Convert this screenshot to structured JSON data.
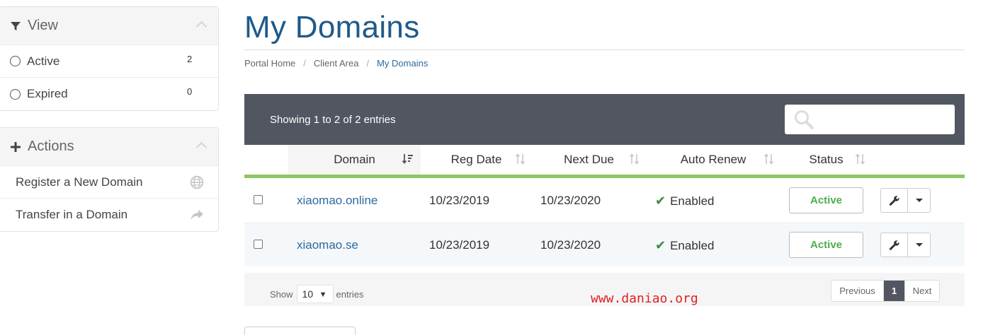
{
  "sidebar": {
    "view": {
      "title": "View",
      "items": [
        {
          "label": "Active",
          "count": "2"
        },
        {
          "label": "Expired",
          "count": "0"
        }
      ]
    },
    "actions": {
      "title": "Actions",
      "items": [
        {
          "label": "Register a New Domain",
          "icon": "globe-icon"
        },
        {
          "label": "Transfer in a Domain",
          "icon": "share-arrow-icon"
        }
      ]
    }
  },
  "page": {
    "title": "My Domains",
    "breadcrumb": [
      "Portal Home",
      "Client Area",
      "My Domains"
    ]
  },
  "table": {
    "info": "Showing 1 to 2 of 2 entries",
    "search_placeholder": "",
    "columns": [
      "Domain",
      "Reg Date",
      "Next Due",
      "Auto Renew",
      "Status"
    ],
    "rows": [
      {
        "domain": "xiaomao.online",
        "reg_date": "10/23/2019",
        "next_due": "10/23/2020",
        "auto_renew": "Enabled",
        "status": "Active"
      },
      {
        "domain": "xiaomao.se",
        "reg_date": "10/23/2019",
        "next_due": "10/23/2020",
        "auto_renew": "Enabled",
        "status": "Active"
      }
    ],
    "footer": {
      "show_label": "Show",
      "page_length": "10",
      "entries_label": "entries",
      "previous": "Previous",
      "current_page": "1",
      "next": "Next"
    }
  },
  "watermark": "www.daniao.org",
  "colors": {
    "title": "#1f5a8a",
    "link": "#2b6aa0",
    "table_header_bar": "#525660",
    "accent_green": "#8cc665",
    "status_green": "#4cae4c"
  }
}
